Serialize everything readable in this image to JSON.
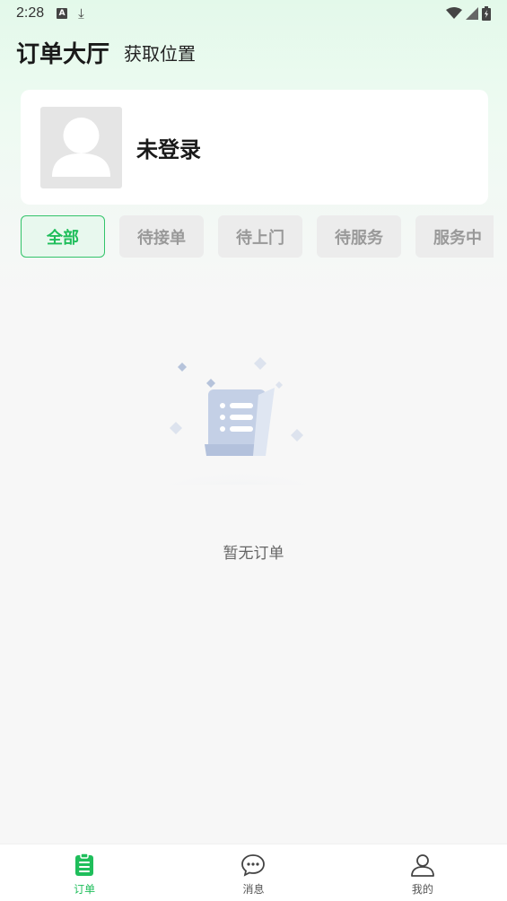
{
  "status_bar": {
    "time": "2:28",
    "notification_icons": [
      "a-icon",
      "download-icon"
    ],
    "system_icons": [
      "wifi-icon",
      "signal-icon",
      "battery-icon"
    ]
  },
  "header": {
    "title": "订单大厅",
    "location_button": "获取位置"
  },
  "user_card": {
    "avatar_icon": "default-avatar-icon",
    "name": "未登录"
  },
  "tabs": [
    {
      "label": "全部",
      "active": true
    },
    {
      "label": "待接单",
      "active": false
    },
    {
      "label": "待上门",
      "active": false
    },
    {
      "label": "待服务",
      "active": false
    },
    {
      "label": "服务中",
      "active": false
    }
  ],
  "empty_state": {
    "icon": "empty-list-scroll-icon",
    "text": "暂无订单"
  },
  "bottom_nav": [
    {
      "label": "订单",
      "icon": "order-icon",
      "active": true
    },
    {
      "label": "消息",
      "icon": "message-icon",
      "active": false
    },
    {
      "label": "我的",
      "icon": "profile-icon",
      "active": false
    }
  ],
  "colors": {
    "accent": "#1fbe5b",
    "header_gradient": "#e3f9ea",
    "background": "#f7f7f7"
  }
}
